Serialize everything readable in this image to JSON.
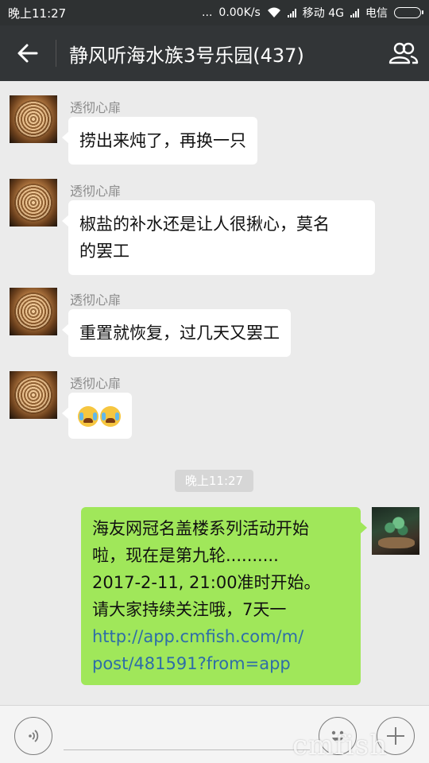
{
  "status_bar": {
    "time": "晚上11:27",
    "dots": "...",
    "speed": "0.00K/s",
    "carrier1": "移动 4G",
    "carrier2": "电信"
  },
  "header": {
    "title": "静风听海水族3号乐园(437)"
  },
  "messages": [
    {
      "sender": "透彻心扉",
      "text": "捞出来炖了，再换一只"
    },
    {
      "sender": "透彻心扉",
      "line1": "椒盐的补水还是让人很揪心，莫名",
      "line2": "的罢工"
    },
    {
      "sender": "透彻心扉",
      "text": "重置就恢复，过几天又罢工"
    },
    {
      "sender": "透彻心扉",
      "emojis": [
        "crying-emoji",
        "crying-emoji"
      ]
    }
  ],
  "timestamp": "晚上11:27",
  "my_message": {
    "line1": "海友网冠名盖楼系列活动开始",
    "line2": "啦，现在是第九轮..........",
    "line3": "2017-2-11, 21:00准时开始。",
    "line4": "请大家持续关注哦，7天一",
    "link_line1": "http://app.cmfish.com/m/",
    "link_line2": "post/481591?from=app"
  },
  "watermark": "cmfish",
  "colors": {
    "header_bg": "#323537",
    "chat_bg": "#ebebeb",
    "my_bubble": "#a0e75a",
    "link": "#2e6da8"
  }
}
